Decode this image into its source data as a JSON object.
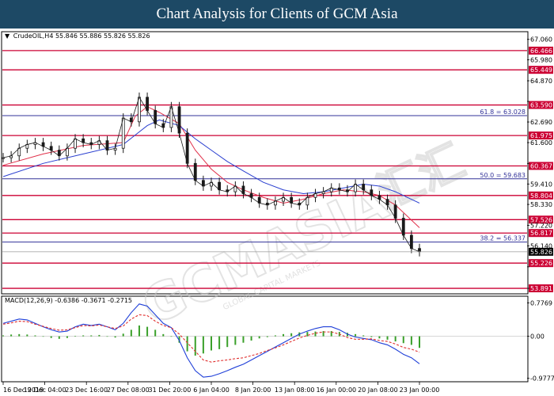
{
  "header": {
    "title": "Chart Analysis for Clients of GCM Asia"
  },
  "chart_data": [
    {
      "type": "line",
      "title": "CrudeOIL,H4  55.846 55.886 55.826 55.826",
      "symbol": "CrudeOIL,H4",
      "ohlc": [
        "55.846",
        "55.886",
        "55.826",
        "55.826"
      ],
      "x_tick_labels": [
        "16 Dec 2019",
        "19 Dec 04:00",
        "23 Dec 16:00",
        "27 Dec 08:00",
        "31 Dec 20:00",
        "6 Jan 04:00",
        "8 Jan 20:00",
        "13 Jan 08:00",
        "16 Jan 00:00",
        "20 Jan 08:00",
        "23 Jan 00:00"
      ],
      "y_tick_labels": [
        "67.060",
        "65.980",
        "64.870",
        "63.780",
        "62.690",
        "61.600",
        "60.500",
        "59.410",
        "58.330",
        "57.220",
        "56.140",
        "55.030",
        "53.891"
      ],
      "ylim": [
        53.891,
        67.06
      ],
      "current_price": "55.826",
      "horizontal_levels": [
        {
          "value": 66.466,
          "label": "66.466",
          "kind": "resistance"
        },
        {
          "value": 65.449,
          "label": "65.449",
          "kind": "resistance"
        },
        {
          "value": 63.59,
          "label": "63.590",
          "kind": "resistance"
        },
        {
          "value": 61.975,
          "label": "61.975",
          "kind": "resistance"
        },
        {
          "value": 60.367,
          "label": "60.367",
          "kind": "resistance"
        },
        {
          "value": 58.804,
          "label": "58.804",
          "kind": "resistance"
        },
        {
          "value": 57.526,
          "label": "57.526",
          "kind": "resistance"
        },
        {
          "value": 56.817,
          "label": "56.817",
          "kind": "resistance"
        },
        {
          "value": 55.226,
          "label": "55.226",
          "kind": "support"
        },
        {
          "value": 53.891,
          "label": "53.891",
          "kind": "support"
        }
      ],
      "fibonacci_levels": [
        {
          "value": 63.028,
          "label": "61.8 = 63.028"
        },
        {
          "value": 59.683,
          "label": "50.0 = 59.683"
        },
        {
          "value": 56.337,
          "label": "38.2 = 56.337"
        }
      ],
      "series": [
        {
          "kind": "price",
          "x": [
            0,
            4,
            8,
            12,
            16,
            20,
            24,
            28,
            32,
            36,
            40,
            44,
            48,
            52,
            56,
            60,
            64,
            68,
            72,
            76,
            80,
            84,
            88,
            92,
            96,
            100,
            104,
            108,
            112,
            116,
            120,
            124,
            128,
            132,
            136,
            140,
            144,
            148,
            152,
            156,
            160,
            164,
            168,
            172,
            176,
            180,
            184,
            188,
            192,
            196,
            200,
            204,
            208
          ],
          "values": [
            60.8,
            60.9,
            61.3,
            61.5,
            61.6,
            61.4,
            61.2,
            60.9,
            61.3,
            61.8,
            61.6,
            61.5,
            61.7,
            61.2,
            61.3,
            62.9,
            62.7,
            64.0,
            63.3,
            62.6,
            62.4,
            63.5,
            62.1,
            60.5,
            59.6,
            59.3,
            59.5,
            59.1,
            59.0,
            59.3,
            58.9,
            58.7,
            58.4,
            58.3,
            58.5,
            58.7,
            58.4,
            58.3,
            58.7,
            58.9,
            59.0,
            59.2,
            59.1,
            59.0,
            59.4,
            59.1,
            58.8,
            58.6,
            58.3,
            57.6,
            56.7,
            56.0,
            55.83
          ]
        },
        {
          "kind": "ma-red",
          "x": [
            0,
            20,
            40,
            60,
            66,
            72,
            78,
            88,
            96,
            104,
            112,
            120,
            130,
            140,
            150,
            160,
            170,
            180,
            188,
            196,
            202,
            208
          ],
          "values": [
            60.4,
            61.0,
            61.45,
            61.6,
            63.0,
            63.5,
            63.2,
            62.6,
            61.2,
            60.2,
            59.5,
            59.1,
            58.7,
            58.4,
            58.6,
            58.9,
            59.1,
            59.0,
            58.8,
            58.3,
            57.7,
            57.1
          ]
        },
        {
          "kind": "ma-blue",
          "x": [
            0,
            20,
            40,
            60,
            66,
            72,
            78,
            88,
            96,
            104,
            112,
            120,
            130,
            140,
            150,
            160,
            170,
            180,
            188,
            196,
            202,
            208
          ],
          "values": [
            59.8,
            60.5,
            61.0,
            61.5,
            62.0,
            62.5,
            62.8,
            62.5,
            61.8,
            61.2,
            60.6,
            60.1,
            59.5,
            59.1,
            58.9,
            59.0,
            59.2,
            59.4,
            59.3,
            59.0,
            58.7,
            58.4
          ]
        }
      ]
    },
    {
      "type": "bar",
      "title": "MACD(12,26,9) -0.6386 -0.3671 -0.2715",
      "indicator": "MACD(12,26,9)",
      "readout": [
        "-0.6386",
        "-0.3671",
        "-0.2715"
      ],
      "y_tick_labels": [
        "0.7769",
        "0.00",
        "-0.9777"
      ],
      "ylim": [
        -0.9777,
        0.7769
      ],
      "x": [
        0,
        4,
        8,
        12,
        16,
        20,
        24,
        28,
        32,
        36,
        40,
        44,
        48,
        52,
        56,
        60,
        64,
        68,
        72,
        76,
        80,
        84,
        88,
        92,
        96,
        100,
        104,
        108,
        112,
        116,
        120,
        124,
        128,
        132,
        136,
        140,
        144,
        148,
        152,
        156,
        160,
        164,
        168,
        172,
        176,
        180,
        184,
        188,
        192,
        196,
        200,
        204,
        208
      ],
      "histogram": [
        0.02,
        0.04,
        0.05,
        0.04,
        0.02,
        -0.01,
        -0.04,
        -0.06,
        -0.04,
        0.01,
        0.02,
        0.02,
        0.03,
        0.0,
        -0.03,
        0.06,
        0.15,
        0.25,
        0.22,
        0.15,
        0.05,
        0.0,
        -0.15,
        -0.35,
        -0.45,
        -0.4,
        -0.33,
        -0.3,
        -0.25,
        -0.2,
        -0.15,
        -0.1,
        -0.05,
        -0.02,
        0.02,
        0.05,
        0.07,
        0.09,
        0.1,
        0.11,
        0.12,
        0.12,
        0.1,
        0.08,
        0.05,
        0.02,
        -0.02,
        -0.05,
        -0.08,
        -0.12,
        -0.16,
        -0.2,
        -0.27
      ],
      "series": [
        {
          "kind": "macd-main",
          "values": [
            0.3,
            0.35,
            0.4,
            0.38,
            0.3,
            0.22,
            0.15,
            0.1,
            0.12,
            0.22,
            0.28,
            0.25,
            0.28,
            0.22,
            0.15,
            0.3,
            0.55,
            0.75,
            0.7,
            0.5,
            0.3,
            0.2,
            -0.1,
            -0.5,
            -0.8,
            -0.95,
            -0.93,
            -0.87,
            -0.8,
            -0.72,
            -0.65,
            -0.55,
            -0.45,
            -0.35,
            -0.25,
            -0.15,
            -0.05,
            0.05,
            0.12,
            0.18,
            0.22,
            0.22,
            0.15,
            0.05,
            -0.02,
            -0.05,
            -0.08,
            -0.15,
            -0.2,
            -0.3,
            -0.42,
            -0.5,
            -0.64
          ]
        },
        {
          "kind": "macd-signal",
          "values": [
            0.28,
            0.31,
            0.35,
            0.34,
            0.28,
            0.23,
            0.18,
            0.14,
            0.15,
            0.2,
            0.25,
            0.24,
            0.26,
            0.22,
            0.18,
            0.24,
            0.4,
            0.5,
            0.48,
            0.35,
            0.25,
            0.2,
            0.05,
            -0.15,
            -0.35,
            -0.55,
            -0.6,
            -0.57,
            -0.55,
            -0.52,
            -0.5,
            -0.45,
            -0.4,
            -0.33,
            -0.27,
            -0.2,
            -0.12,
            -0.04,
            0.02,
            0.07,
            0.1,
            0.1,
            0.05,
            -0.03,
            -0.07,
            -0.07,
            -0.06,
            -0.1,
            -0.12,
            -0.18,
            -0.26,
            -0.3,
            -0.37
          ]
        }
      ]
    }
  ],
  "watermark": {
    "main": "GCMASIA",
    "sub": "GLOBAL CAPITAL MARKETS",
    "chinese": "汇汇"
  },
  "colors": {
    "header_bg": "#1d4965",
    "level_line": "#cc0033",
    "fib_line": "#333399",
    "ma_red": "#e0304a",
    "ma_blue": "#2a3fd0",
    "macd_main": "#1f3fd8",
    "macd_signal": "#e0302f",
    "macd_hist": "#3aa02a",
    "price": "#1a1a1a",
    "last_price_bg": "#000000"
  }
}
